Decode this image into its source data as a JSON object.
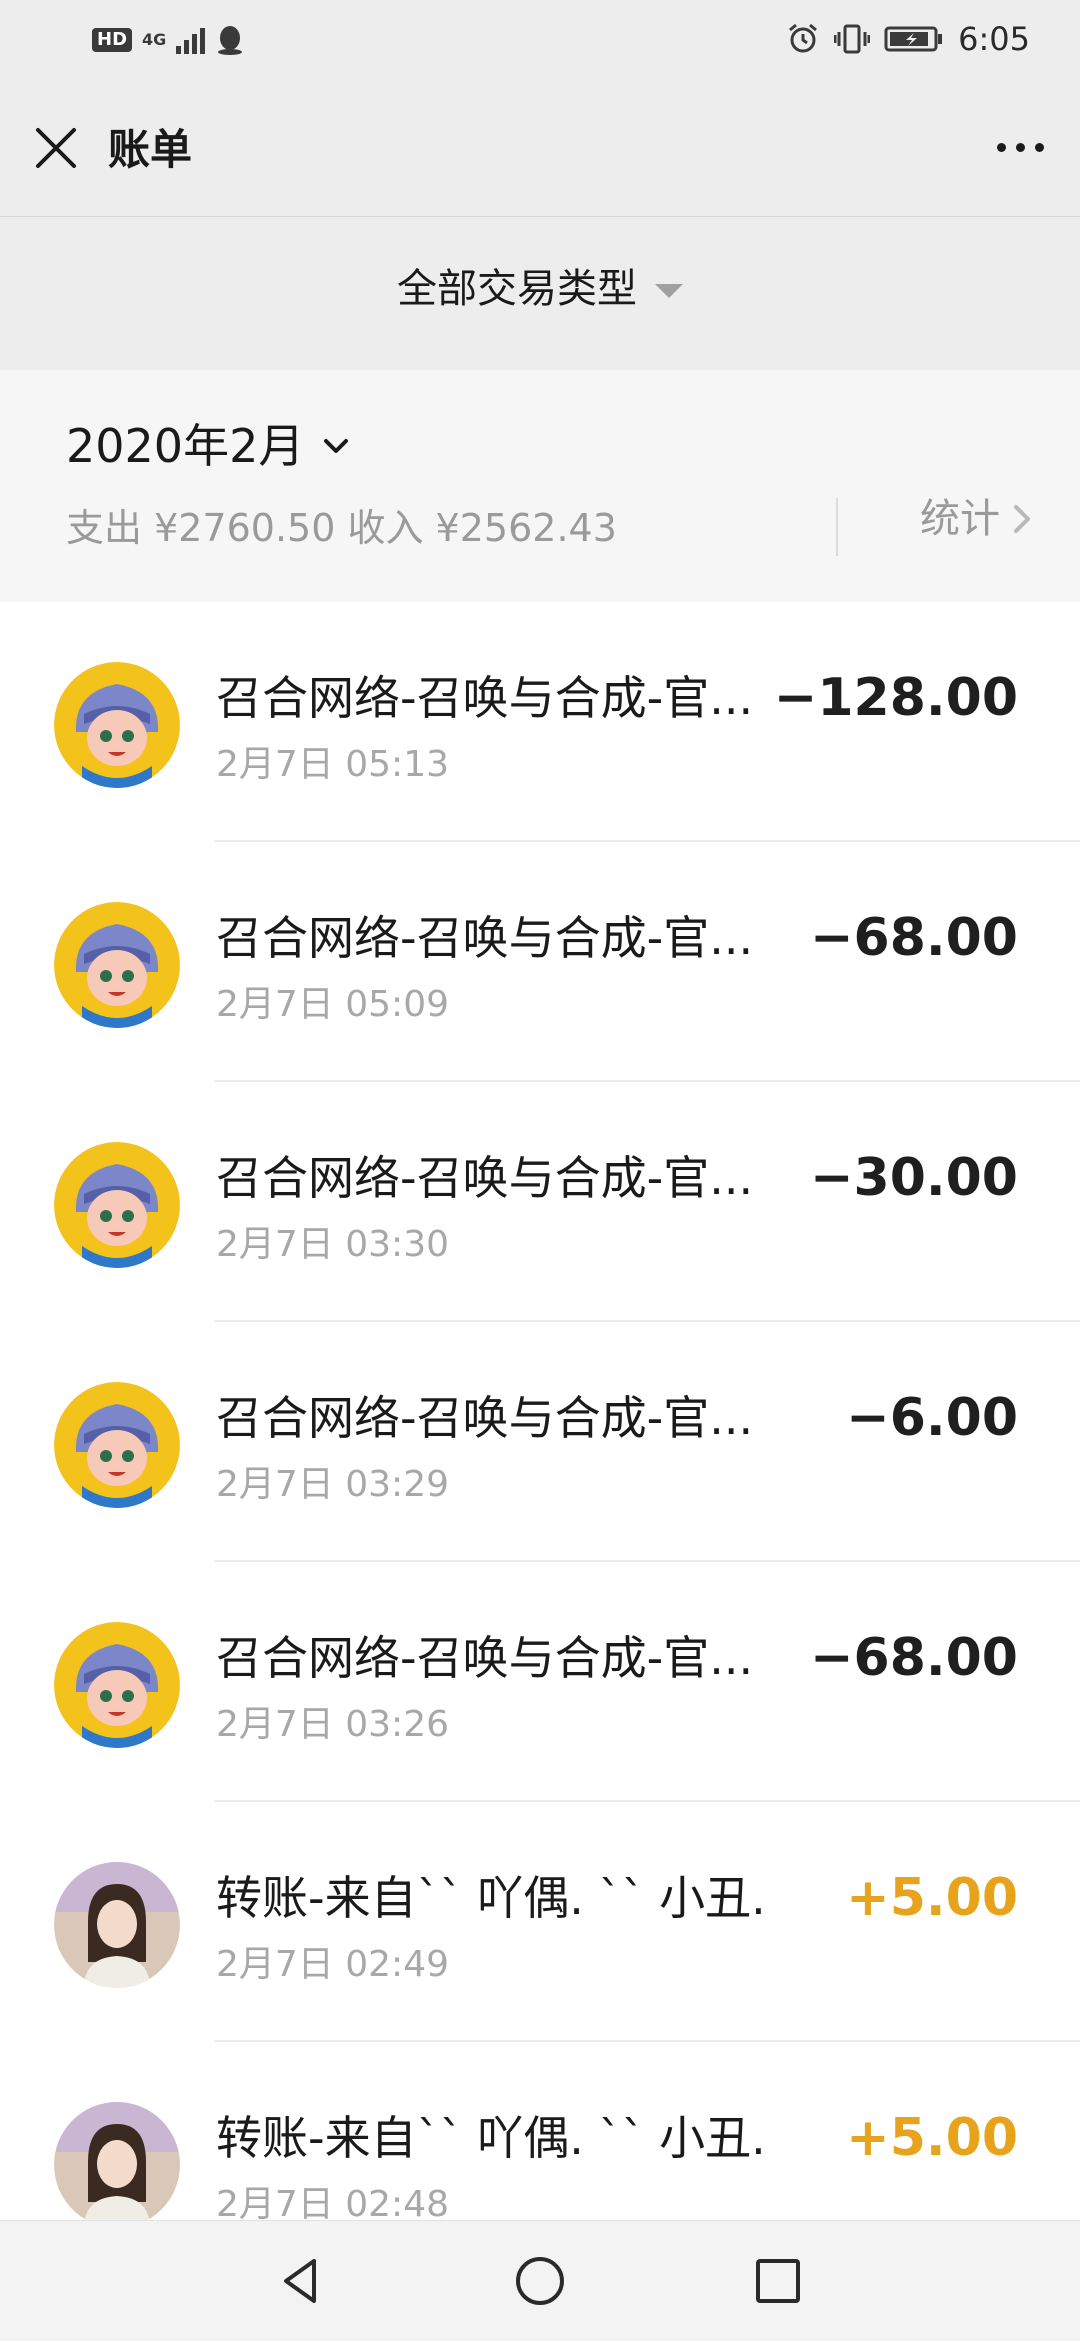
{
  "status_bar": {
    "hd": "HD",
    "network": "4G",
    "time": "6:05"
  },
  "header": {
    "title": "账单",
    "close_icon": "close-icon",
    "more_icon": "more-dots-icon"
  },
  "filter": {
    "label": "全部交易类型"
  },
  "summary": {
    "month": "2020年2月",
    "totals": "支出 ¥2760.50 收入 ¥2562.43",
    "stats_label": "统计"
  },
  "transactions": [
    {
      "title": "召合网络-召唤与合成-官...",
      "time": "2月7日 05:13",
      "amount": "−128.00",
      "type": "expense",
      "avatar": "game-avatar"
    },
    {
      "title": "召合网络-召唤与合成-官...",
      "time": "2月7日 05:09",
      "amount": "−68.00",
      "type": "expense",
      "avatar": "game-avatar"
    },
    {
      "title": "召合网络-召唤与合成-官...",
      "time": "2月7日 03:30",
      "amount": "−30.00",
      "type": "expense",
      "avatar": "game-avatar"
    },
    {
      "title": "召合网络-召唤与合成-官...",
      "time": "2月7日 03:29",
      "amount": "−6.00",
      "type": "expense",
      "avatar": "game-avatar"
    },
    {
      "title": "召合网络-召唤与合成-官...",
      "time": "2月7日 03:26",
      "amount": "−68.00",
      "type": "expense",
      "avatar": "game-avatar"
    },
    {
      "title": "转账-来自`` 吖偶. `` 小丑.",
      "time": "2月7日 02:49",
      "amount": "+5.00",
      "type": "income",
      "avatar": "user-photo-avatar"
    },
    {
      "title": "转账-来自`` 吖偶. `` 小丑.",
      "time": "2月7日 02:48",
      "amount": "+5.00",
      "type": "income",
      "avatar": "user-photo-avatar"
    }
  ],
  "colors": {
    "income": "#e6a31b",
    "expense": "#1f1f1f",
    "header_bg": "#ededed",
    "summary_bg": "#f6f6f6"
  },
  "nav": {
    "back_icon": "back-triangle-icon",
    "home_icon": "home-circle-icon",
    "recent_icon": "recent-square-icon"
  }
}
